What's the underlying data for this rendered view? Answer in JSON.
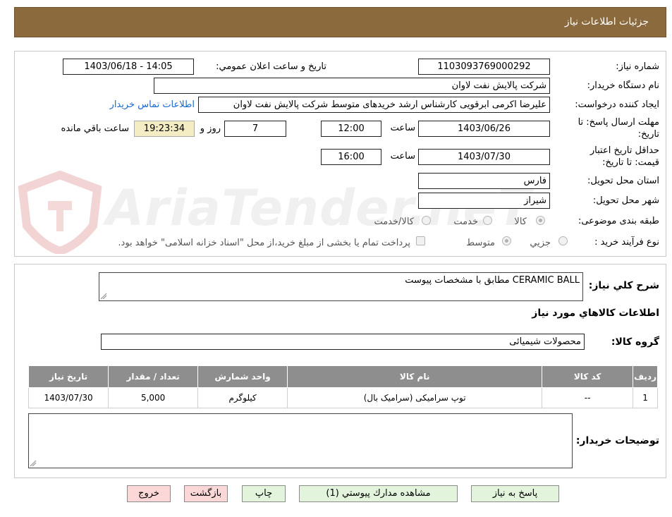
{
  "header": {
    "title": "جزئیات اطلاعات نیاز"
  },
  "form": {
    "need_number": {
      "label": "شماره نیاز:",
      "value": "1103093769000292"
    },
    "announce": {
      "label": "تاریخ و ساعت اعلان عمومي:",
      "value": "1403/06/18 - 14:05"
    },
    "buyer_org": {
      "label": "نام دستگاه خريدار:",
      "value": "شرکت پالایش نفت لاوان"
    },
    "requester": {
      "label": "ايجاد کننده درخواست:",
      "value": "علیرضا اکرمی ابرقویی کارشناس ارشد خریدهای متوسط شرکت پالایش نفت لاوان",
      "contact_link": "اطلاعات تماس خريدار"
    },
    "reply_deadline": {
      "label1": "مهلت ارسال پاسخ: تا",
      "label2": "تاريخ:",
      "date": "1403/06/26",
      "time_label": "ساعت",
      "time": "12:00",
      "days": "7",
      "days_label": "روز و",
      "remaining": "19:23:34",
      "remaining_label": "ساعت باقي مانده"
    },
    "validity": {
      "label1": "حداقل تاريخ اعتبار",
      "label2": "قيمت: تا تاريخ:",
      "date": "1403/07/30",
      "time_label": "ساعت",
      "time": "16:00"
    },
    "province": {
      "label": "استان محل تحويل:",
      "value": "فارس"
    },
    "city": {
      "label": "شهر محل تحويل:",
      "value": "شیراز"
    },
    "category": {
      "label": "طبقه بندی موضوعی:",
      "options": [
        "کالا",
        "خدمت",
        "کالا/خدمت"
      ],
      "selected": "کالا"
    },
    "process": {
      "label": "نوع فرآيند خريد :",
      "options": [
        "جزيي",
        "متوسط"
      ],
      "selected": "متوسط",
      "treasury_note": "پرداخت تمام یا بخشی از مبلغ خرید،از محل \"اسناد خزانه اسلامی\" خواهد بود."
    }
  },
  "summary": {
    "label": "شرح کلي نياز:",
    "value": "CERAMIC BALL مطابق با مشخصات پیوست"
  },
  "goods_section": {
    "title": "اطلاعات کالاهاي مورد نياز"
  },
  "goods_group": {
    "label": "گروه کالا:",
    "value": "محصولات شیمیائی"
  },
  "table": {
    "headers": [
      "رديف",
      "کد کالا",
      "نام کالا",
      "واحد شمارش",
      "تعداد / مقدار",
      "تاريخ نياز"
    ],
    "rows": [
      [
        "1",
        "--",
        "توپ سرامیکی (سرامیک بال)",
        "کیلوگرم",
        "5,000",
        "1403/07/30"
      ]
    ]
  },
  "buyer_notes": {
    "label": "توضيحات خريدار:",
    "value": ""
  },
  "buttons": {
    "reply": "پاسخ به نياز",
    "attachments": "مشاهده مدارك پيوستي (1)",
    "print": "چاپ",
    "back": "بازگشت",
    "exit": "خروج"
  },
  "watermark": "AriaTender.neT",
  "colors": {
    "header_bg": "#8b6a3e",
    "table_header": "#8e8e8e",
    "link": "#1a6acb",
    "btn_green": "#e2f4dc",
    "btn_pink": "#fbd7d7",
    "remaining_bg": "#f4ecc2"
  }
}
